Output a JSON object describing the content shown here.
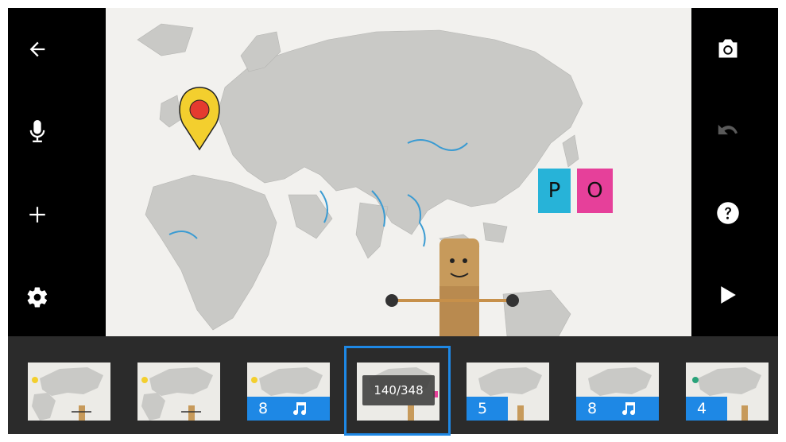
{
  "toolbar_left": {
    "back_icon": "arrow-left-icon",
    "mic_icon": "microphone-icon",
    "add_icon": "plus-icon",
    "settings_icon": "gear-icon"
  },
  "toolbar_right": {
    "camera_icon": "camera-icon",
    "undo_icon": "undo-icon",
    "help_icon": "help-icon",
    "play_icon": "play-icon"
  },
  "viewport": {
    "sticky_note_left": "P",
    "sticky_note_right": "O",
    "colors": {
      "note_blue": "#27b3d8",
      "note_pink": "#e6409a",
      "pin_yellow": "#f3cf2e",
      "pin_red": "#e53a2f"
    }
  },
  "timeline": {
    "frame_counter": "140/348",
    "frames": [
      {
        "badge": "",
        "has_music": false
      },
      {
        "badge": "",
        "has_music": false
      },
      {
        "badge": "8",
        "has_music": true
      },
      {
        "badge": "",
        "has_music": false,
        "selected": true
      },
      {
        "badge": "5",
        "has_music": false
      },
      {
        "badge": "8",
        "has_music": true
      },
      {
        "badge": "4",
        "has_music": false
      }
    ],
    "accent_color": "#1e88e5"
  }
}
